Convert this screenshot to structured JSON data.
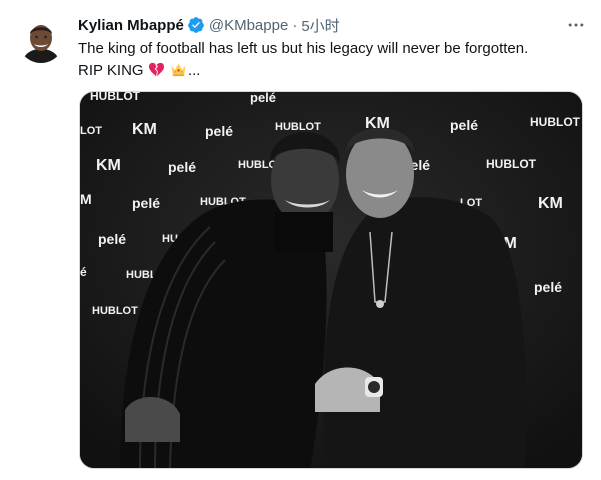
{
  "tweet": {
    "author": {
      "display_name": "Kylian Mbappé",
      "handle": "@KMbappe",
      "verified": true
    },
    "separator": "·",
    "time": "5小时",
    "text_line1": "The king of football has left us but his legacy will never be forgotten.",
    "text_line2_prefix": "RIP KING",
    "text_line2_suffix": "...",
    "emojis": [
      "broken-heart",
      "crown"
    ]
  },
  "photo": {
    "backdrop_logos": [
      "KM",
      "pelé",
      "HUBLOT"
    ]
  },
  "colors": {
    "verified_blue": "#1d9bf0",
    "secondary_text": "#536471",
    "broken_heart": "#e0245e",
    "crown": "#ffcc4d"
  },
  "icons": {
    "verified": "verified-badge-icon",
    "more": "more-dots-icon"
  }
}
